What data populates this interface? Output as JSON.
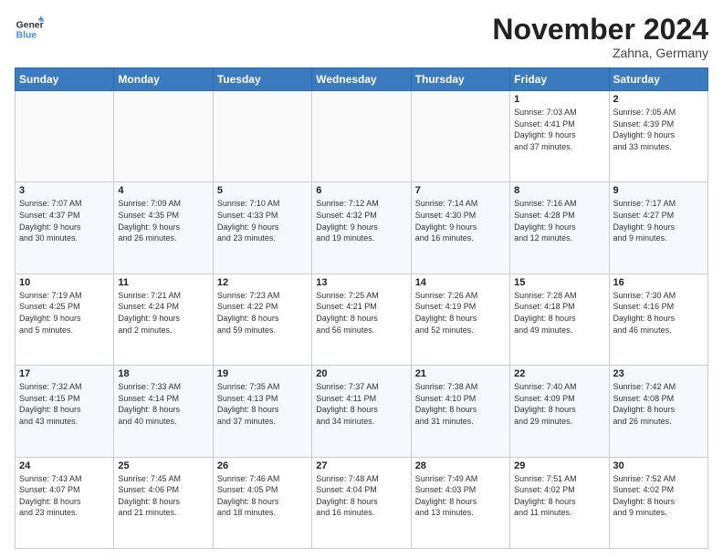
{
  "header": {
    "logo_line1": "General",
    "logo_line2": "Blue",
    "month_title": "November 2024",
    "location": "Zahna, Germany"
  },
  "weekdays": [
    "Sunday",
    "Monday",
    "Tuesday",
    "Wednesday",
    "Thursday",
    "Friday",
    "Saturday"
  ],
  "weeks": [
    [
      {
        "day": "",
        "info": ""
      },
      {
        "day": "",
        "info": ""
      },
      {
        "day": "",
        "info": ""
      },
      {
        "day": "",
        "info": ""
      },
      {
        "day": "",
        "info": ""
      },
      {
        "day": "1",
        "info": "Sunrise: 7:03 AM\nSunset: 4:41 PM\nDaylight: 9 hours\nand 37 minutes."
      },
      {
        "day": "2",
        "info": "Sunrise: 7:05 AM\nSunset: 4:39 PM\nDaylight: 9 hours\nand 33 minutes."
      }
    ],
    [
      {
        "day": "3",
        "info": "Sunrise: 7:07 AM\nSunset: 4:37 PM\nDaylight: 9 hours\nand 30 minutes."
      },
      {
        "day": "4",
        "info": "Sunrise: 7:09 AM\nSunset: 4:35 PM\nDaylight: 9 hours\nand 26 minutes."
      },
      {
        "day": "5",
        "info": "Sunrise: 7:10 AM\nSunset: 4:33 PM\nDaylight: 9 hours\nand 23 minutes."
      },
      {
        "day": "6",
        "info": "Sunrise: 7:12 AM\nSunset: 4:32 PM\nDaylight: 9 hours\nand 19 minutes."
      },
      {
        "day": "7",
        "info": "Sunrise: 7:14 AM\nSunset: 4:30 PM\nDaylight: 9 hours\nand 16 minutes."
      },
      {
        "day": "8",
        "info": "Sunrise: 7:16 AM\nSunset: 4:28 PM\nDaylight: 9 hours\nand 12 minutes."
      },
      {
        "day": "9",
        "info": "Sunrise: 7:17 AM\nSunset: 4:27 PM\nDaylight: 9 hours\nand 9 minutes."
      }
    ],
    [
      {
        "day": "10",
        "info": "Sunrise: 7:19 AM\nSunset: 4:25 PM\nDaylight: 9 hours\nand 5 minutes."
      },
      {
        "day": "11",
        "info": "Sunrise: 7:21 AM\nSunset: 4:24 PM\nDaylight: 9 hours\nand 2 minutes."
      },
      {
        "day": "12",
        "info": "Sunrise: 7:23 AM\nSunset: 4:22 PM\nDaylight: 8 hours\nand 59 minutes."
      },
      {
        "day": "13",
        "info": "Sunrise: 7:25 AM\nSunset: 4:21 PM\nDaylight: 8 hours\nand 56 minutes."
      },
      {
        "day": "14",
        "info": "Sunrise: 7:26 AM\nSunset: 4:19 PM\nDaylight: 8 hours\nand 52 minutes."
      },
      {
        "day": "15",
        "info": "Sunrise: 7:28 AM\nSunset: 4:18 PM\nDaylight: 8 hours\nand 49 minutes."
      },
      {
        "day": "16",
        "info": "Sunrise: 7:30 AM\nSunset: 4:16 PM\nDaylight: 8 hours\nand 46 minutes."
      }
    ],
    [
      {
        "day": "17",
        "info": "Sunrise: 7:32 AM\nSunset: 4:15 PM\nDaylight: 8 hours\nand 43 minutes."
      },
      {
        "day": "18",
        "info": "Sunrise: 7:33 AM\nSunset: 4:14 PM\nDaylight: 8 hours\nand 40 minutes."
      },
      {
        "day": "19",
        "info": "Sunrise: 7:35 AM\nSunset: 4:13 PM\nDaylight: 8 hours\nand 37 minutes."
      },
      {
        "day": "20",
        "info": "Sunrise: 7:37 AM\nSunset: 4:11 PM\nDaylight: 8 hours\nand 34 minutes."
      },
      {
        "day": "21",
        "info": "Sunrise: 7:38 AM\nSunset: 4:10 PM\nDaylight: 8 hours\nand 31 minutes."
      },
      {
        "day": "22",
        "info": "Sunrise: 7:40 AM\nSunset: 4:09 PM\nDaylight: 8 hours\nand 29 minutes."
      },
      {
        "day": "23",
        "info": "Sunrise: 7:42 AM\nSunset: 4:08 PM\nDaylight: 8 hours\nand 26 minutes."
      }
    ],
    [
      {
        "day": "24",
        "info": "Sunrise: 7:43 AM\nSunset: 4:07 PM\nDaylight: 8 hours\nand 23 minutes."
      },
      {
        "day": "25",
        "info": "Sunrise: 7:45 AM\nSunset: 4:06 PM\nDaylight: 8 hours\nand 21 minutes."
      },
      {
        "day": "26",
        "info": "Sunrise: 7:46 AM\nSunset: 4:05 PM\nDaylight: 8 hours\nand 18 minutes."
      },
      {
        "day": "27",
        "info": "Sunrise: 7:48 AM\nSunset: 4:04 PM\nDaylight: 8 hours\nand 16 minutes."
      },
      {
        "day": "28",
        "info": "Sunrise: 7:49 AM\nSunset: 4:03 PM\nDaylight: 8 hours\nand 13 minutes."
      },
      {
        "day": "29",
        "info": "Sunrise: 7:51 AM\nSunset: 4:02 PM\nDaylight: 8 hours\nand 11 minutes."
      },
      {
        "day": "30",
        "info": "Sunrise: 7:52 AM\nSunset: 4:02 PM\nDaylight: 8 hours\nand 9 minutes."
      }
    ]
  ]
}
